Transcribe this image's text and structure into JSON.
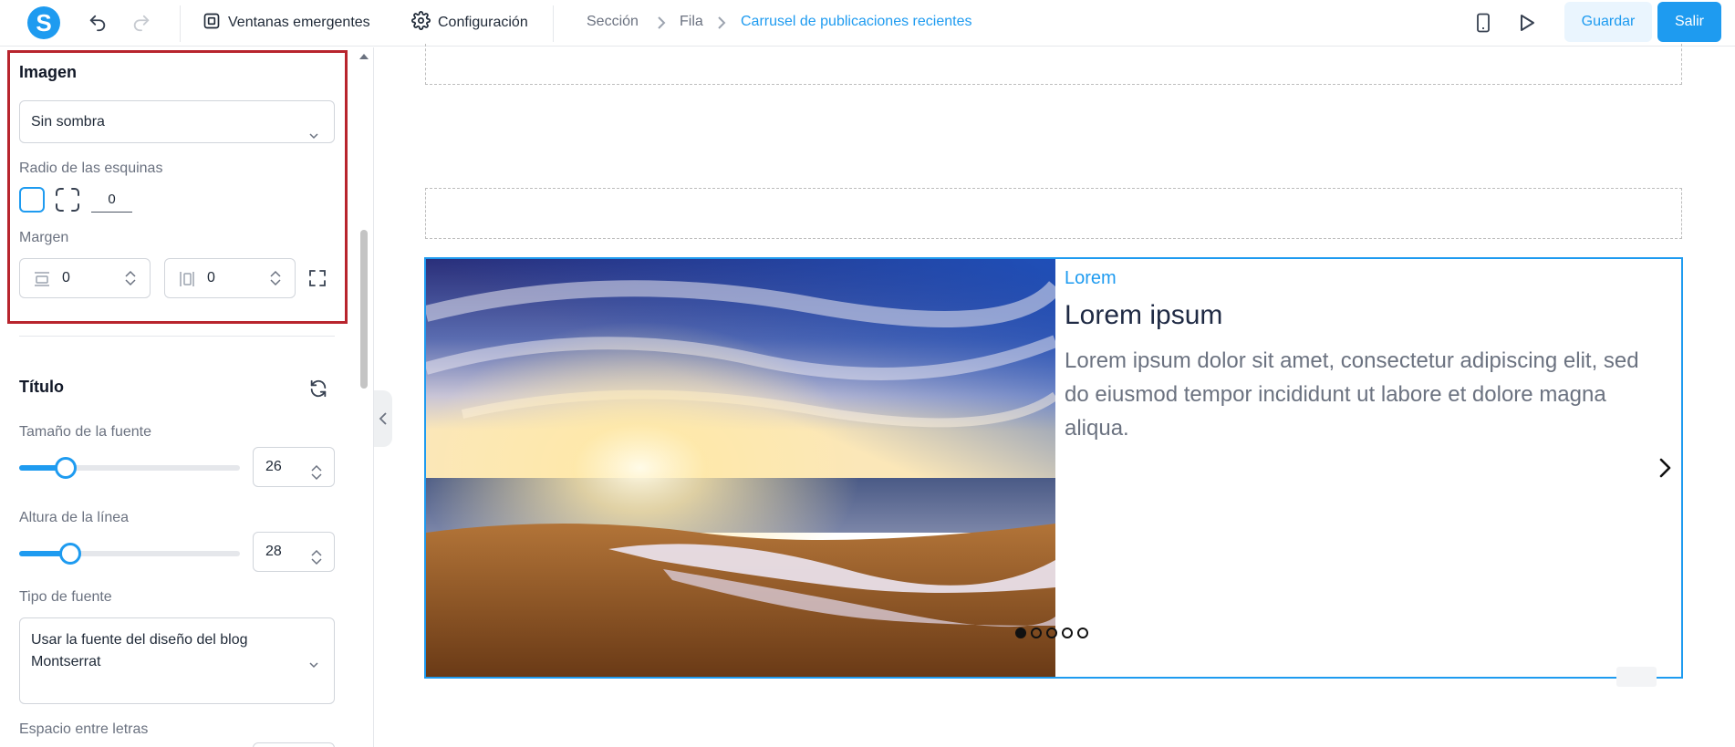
{
  "header": {
    "logo_letter": "S",
    "popups_label": "Ventanas emergentes",
    "settings_label": "Configuración",
    "breadcrumb": [
      "Sección",
      "Fila",
      "Carrusel de publicaciones recientes"
    ],
    "save_label": "Guardar",
    "exit_label": "Salir"
  },
  "panel": {
    "image_section": {
      "title": "Imagen",
      "shadow_value": "Sin sombra",
      "corner_label": "Radio de las esquinas",
      "corner_value": "0",
      "margin_label": "Margen",
      "margin_vertical": "0",
      "margin_horizontal": "0"
    },
    "title_section": {
      "title": "Título",
      "font_size_label": "Tamaño de la fuente",
      "font_size_value": "26",
      "font_size_slider_fraction": 0.18,
      "line_height_label": "Altura de la línea",
      "line_height_value": "28",
      "line_height_slider_fraction": 0.2,
      "font_type_label": "Tipo de fuente",
      "font_type_value_line1": "Usar la fuente del diseño del blog",
      "font_type_value_line2": "Montserrat",
      "letter_spacing_label": "Espacio entre letras"
    }
  },
  "canvas": {
    "post": {
      "category": "Lorem",
      "title": "Lorem ipsum",
      "description": "Lorem ipsum dolor sit amet, consectetur adipiscing elit, sed do eiusmod tempor incididunt ut labore et dolore magna aliqua."
    },
    "dots_count": 5,
    "active_dot": 0
  },
  "colors": {
    "accent": "#1e9bf0",
    "highlight_border": "#b8242d"
  }
}
